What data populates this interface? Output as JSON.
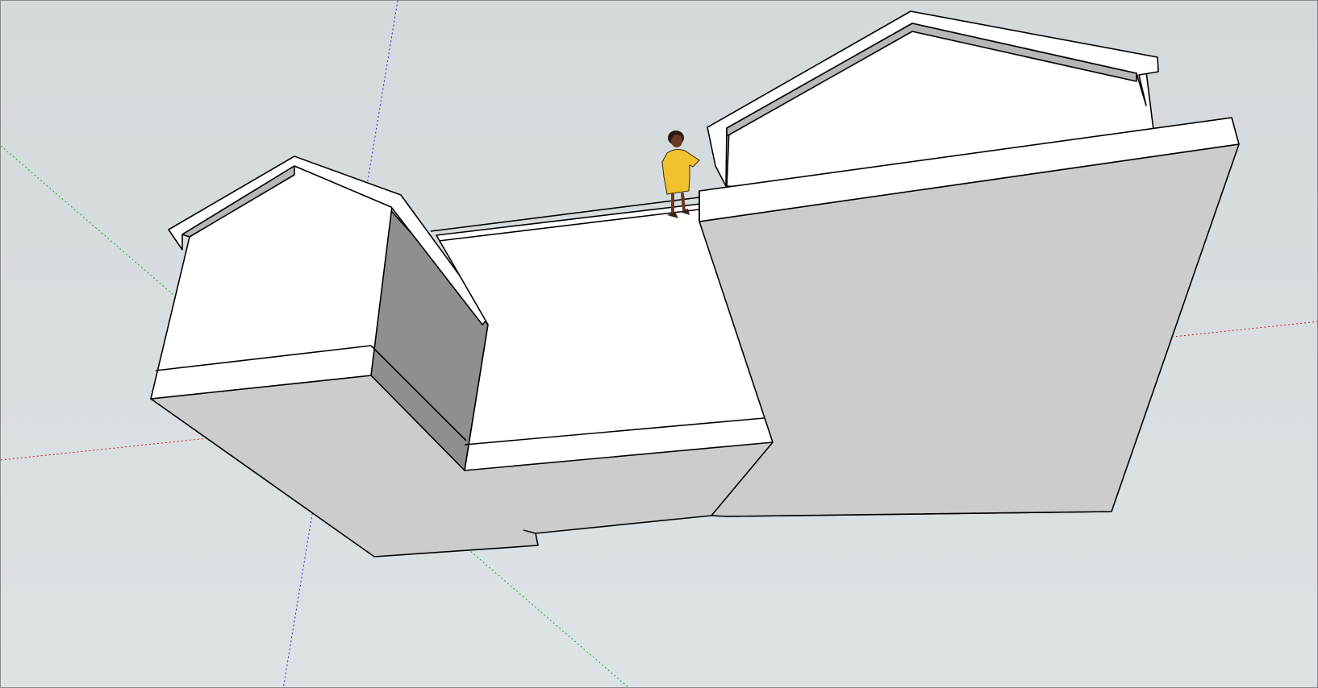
{
  "viewport": {
    "background_sky": "#d4d9dc",
    "background_ground": "#dde2e5"
  },
  "axes": {
    "red": "#cc2222",
    "green": "#22aa22",
    "blue": "#2222cc"
  },
  "model": {
    "face_light": "#ffffff",
    "face_shadow": "#cccccc",
    "face_dark": "#8f8f8f",
    "face_mid": "#b7b7b7",
    "edge": "#000000"
  },
  "figure": {
    "dress": "#f2c12e",
    "skin": "#6b3a22",
    "hair": "#2a1a12",
    "shoes": "#3a2216"
  }
}
